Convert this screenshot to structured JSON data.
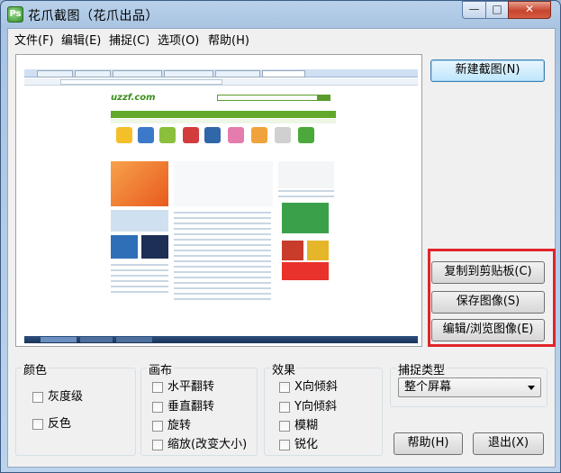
{
  "window": {
    "title": "花爪截图（花爪出品）",
    "app_icon": "Ps",
    "min": "—",
    "max": "□",
    "close": "✕"
  },
  "menu": [
    "文件(F)",
    "编辑(E)",
    "捕捉(C)",
    "选项(O)",
    "帮助(H)"
  ],
  "buttons": {
    "new_capture": "新建截图(N)",
    "copy_clipboard": "复制到剪贴板(C)",
    "save_image": "保存图像(S)",
    "edit_browse": "编辑/浏览图像(E)",
    "help": "帮助(H)",
    "exit": "退出(X)"
  },
  "groups": {
    "color": {
      "label": "颜色",
      "options": [
        "灰度级",
        "反色"
      ]
    },
    "canvas": {
      "label": "画布",
      "options": [
        "水平翻转",
        "垂直翻转",
        "旋转",
        "缩放(改变大小)"
      ]
    },
    "effects": {
      "label": "效果",
      "options": [
        "X向倾斜",
        "Y向倾斜",
        "模糊",
        "锐化"
      ]
    },
    "capture_type": {
      "label": "捕捉类型",
      "selected": "整个屏幕"
    }
  },
  "preview": {
    "logo": "uzzf.com"
  },
  "colors": {
    "highlight": "#e0242a",
    "nav_green": "#62a82b"
  }
}
